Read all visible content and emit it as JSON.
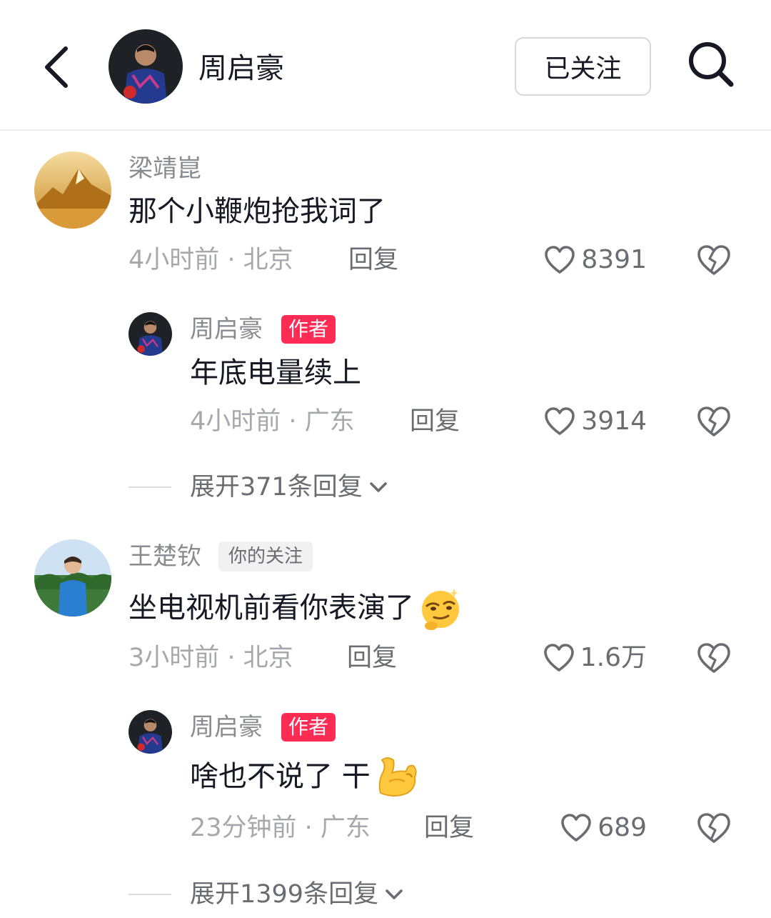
{
  "header": {
    "name": "周启豪",
    "follow_label": "已关注"
  },
  "comments": [
    {
      "username": "梁靖崑",
      "text": "那个小鞭炮抢我词了",
      "meta": "4小时前 · 北京",
      "reply_label": "回复",
      "likes": "8391",
      "reply": {
        "username": "周启豪",
        "badge": "作者",
        "text": "年底电量续上",
        "meta": "4小时前 · 广东",
        "reply_label": "回复",
        "likes": "3914"
      },
      "expand_label": "展开371条回复"
    },
    {
      "username": "王楚钦",
      "badge": "你的关注",
      "text": "坐电视机前看你表演了",
      "emoji": "smirk-emoji",
      "meta": "3小时前 · 北京",
      "reply_label": "回复",
      "likes": "1.6万",
      "reply": {
        "username": "周启豪",
        "badge": "作者",
        "text": "啥也不说了 干",
        "emoji": "flexed-biceps-emoji",
        "meta": "23分钟前 · 广东",
        "reply_label": "回复",
        "likes": "689"
      },
      "expand_label": "展开1399条回复"
    }
  ],
  "colors": {
    "accent": "#fe2c55",
    "text": "#161823",
    "muted": "#a7a8ad"
  }
}
